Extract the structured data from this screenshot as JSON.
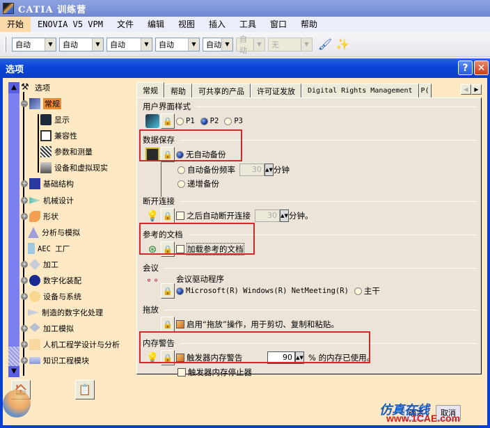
{
  "app": {
    "title": "CATIA 训练营"
  },
  "menu": [
    "开始",
    "ENOVIA V5 VPM",
    "文件",
    "编辑",
    "视图",
    "插入",
    "工具",
    "窗口",
    "帮助"
  ],
  "toolbar": {
    "combos": [
      {
        "value": "自动",
        "enabled": true
      },
      {
        "value": "自动",
        "enabled": true
      },
      {
        "value": "自动",
        "enabled": true
      },
      {
        "value": "自动",
        "enabled": true
      },
      {
        "value": "自动",
        "enabled": true
      },
      {
        "value": "自动",
        "enabled": false
      },
      {
        "value": "无",
        "enabled": false
      }
    ],
    "icons": [
      "paintbrush-icon",
      "magic-wand-icon"
    ]
  },
  "dialog": {
    "title": "选项",
    "help_label": "?",
    "close_label": "✕",
    "tree": {
      "root": "选项",
      "items": [
        {
          "label": "常规",
          "selected": true,
          "expandable": true
        },
        {
          "label": "显示",
          "child": true
        },
        {
          "label": "兼容性",
          "child": true
        },
        {
          "label": "参数和测量",
          "child": true
        },
        {
          "label": "设备和虚拟现实",
          "child": true
        },
        {
          "label": "基础结构",
          "expandable": true
        },
        {
          "label": "机械设计",
          "expandable": true
        },
        {
          "label": "形状",
          "expandable": true
        },
        {
          "label": "分析与模拟"
        },
        {
          "label": "AEC 工厂"
        },
        {
          "label": "加工",
          "expandable": true
        },
        {
          "label": "数字化装配",
          "expandable": true
        },
        {
          "label": "设备与系统",
          "expandable": true
        },
        {
          "label": "制造的数字化处理"
        },
        {
          "label": "加工模拟",
          "expandable": true
        },
        {
          "label": "人机工程学设计与分析",
          "expandable": true
        },
        {
          "label": "知识工程模块",
          "expandable": true
        }
      ]
    },
    "tabs": [
      "常规",
      "帮助",
      "可共享的产品",
      "许可证发放",
      "Digital Rights Management",
      "P("
    ],
    "sections": {
      "ui_style": {
        "title": "用户界面样式",
        "options": [
          "P1",
          "P2",
          "P3"
        ],
        "selected": "P2"
      },
      "data_save": {
        "title": "数据保存",
        "options": [
          "无自动备份",
          "自动备份频率",
          "递增备份"
        ],
        "selected": "无自动备份",
        "freq_value": "30",
        "freq_unit": "分钟"
      },
      "disconnect": {
        "title": "断开连接",
        "checkbox": "之后自动断开连接",
        "checked": false,
        "value": "30",
        "unit": "分钟。"
      },
      "ref_docs": {
        "title": "参考的文档",
        "checkbox": "加载参考的文档",
        "checked": false
      },
      "meeting": {
        "title": "会议",
        "driver_label": "会议驱动程序",
        "options": [
          "Microsoft(R) Windows(R) NetMeeting(R)",
          "主干"
        ],
        "selected": "Microsoft(R) Windows(R) NetMeeting(R)"
      },
      "drag_drop": {
        "title": "拖放",
        "checkbox": "启用“拖放”操作，用于剪切、复制和粘贴。",
        "checked": true
      },
      "memory": {
        "title": "内存警告",
        "checkbox": "触发器内存警告",
        "checked": true,
        "value": "90",
        "suffix": "% 的内存已使用。",
        "stopper": "触发器内存停止器",
        "stopper_checked": false
      }
    },
    "buttons": {
      "ok": "确定",
      "cancel": "取消"
    }
  },
  "watermark": {
    "text": "仿真在线",
    "url": "www.1CAE.com"
  }
}
